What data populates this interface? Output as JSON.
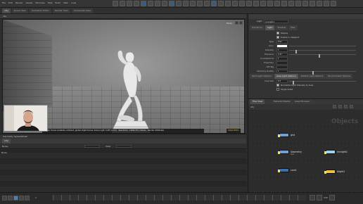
{
  "topbar": {
    "menu": [
      "File",
      "Edit",
      "Render",
      "Assets",
      "Windows",
      "Help",
      "Build",
      "Main",
      "Lops"
    ]
  },
  "tabs": [
    "/obj",
    "Scene View",
    "Animation Editor",
    "Render View",
    "Composite View"
  ],
  "viewport": {
    "path": "obj",
    "corner_label": "Persp",
    "status_text": "Render Scene variables, Ambient, global, Right-Scene, Scene right, CAM (cam1) : Resolution: 1280x720, Details : Render Attributes"
  },
  "lower_left": {
    "title": "Geometry Spreadsheet",
    "tab": "/obj",
    "node_label": "Node:",
    "view_label": "View",
    "col_header": "Node"
  },
  "params": {
    "node_type": "Light",
    "node_name": "envlight1",
    "tabs": [
      "Transform",
      "Light",
      "Shadow",
      "Misc"
    ],
    "rows": [
      {
        "label": "Display",
        "type": "check",
        "on": true,
        "text": "Display"
      },
      {
        "label": "Enable in Viewport",
        "type": "check",
        "on": true,
        "text": "Enable in Viewport"
      },
      {
        "label": "Type",
        "type": "value",
        "value": "Disk"
      },
      {
        "label": "Color",
        "type": "color",
        "value": 1.0
      },
      {
        "label": "Intensity",
        "type": "slider",
        "value": "1",
        "level": 0.1
      },
      {
        "label": "Exposure",
        "type": "slider",
        "value": "4.37",
        "level": 0.45
      },
      {
        "label": "Contributions",
        "type": "value",
        "value": "1"
      },
      {
        "label": "Projection",
        "type": "value",
        "value": ""
      },
      {
        "label": "LPE Tag",
        "type": "value",
        "value": ""
      },
      {
        "label": "Sampling Quality",
        "type": "slider",
        "value": "1",
        "level": 0.35
      }
    ],
    "sub_tabs": [
      "Spot Light Options",
      "Area Light Options",
      "Distant Light Options",
      "Environment Options"
    ],
    "area_rows": [
      {
        "label": "Area Size",
        "type": "slider",
        "value": "0.5",
        "level": 0.05
      },
      {
        "label": "Normalize Light Intensity to Area",
        "type": "check",
        "on": true,
        "text": "Normalize Light Intensity to Area"
      },
      {
        "label": "Single Sided",
        "type": "check",
        "on": false,
        "text": "Single Sided"
      }
    ]
  },
  "network": {
    "tabs": [
      "Tree View",
      "Material Palette",
      "Asset Browser"
    ],
    "path": "obj",
    "tools": [
      "Add",
      "Edit",
      "Go",
      "View",
      "Tools",
      "Layout",
      "Help"
    ],
    "context_label": "Objects",
    "nodes": [
      {
        "name": "grid",
        "sub": "",
        "color": "#6f9fd8"
      },
      {
        "name": "Geometry",
        "sub": "test",
        "color": "#6f9fd8"
      },
      {
        "name": "envlight1",
        "sub": "",
        "color": "#9fd0f0"
      },
      {
        "name": "cam1",
        "sub": "",
        "color": "#3a6fb0"
      },
      {
        "name": "hlight1",
        "sub": "",
        "color": "#f0c040"
      }
    ]
  },
  "timeline": {
    "frame": "1",
    "end": "240"
  },
  "colors": {
    "accent": "#4e7fb3",
    "light_node": "#f0c040"
  }
}
